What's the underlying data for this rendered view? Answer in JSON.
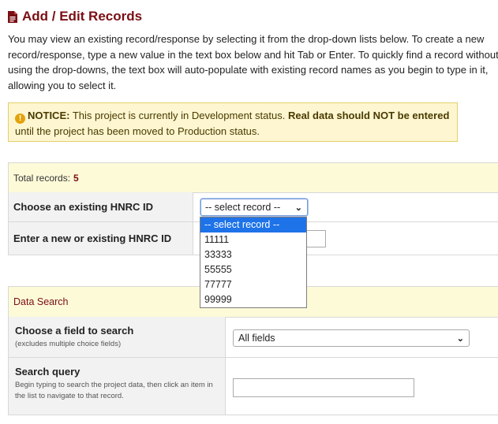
{
  "header": {
    "title": "Add / Edit Records",
    "icon": "document-icon"
  },
  "intro": "You may view an existing record/response by selecting it from the drop-down lists below. To create a new record/response, type a new value in the text box below and hit Tab or Enter. To quickly find a record without using the drop-downs, the text box will auto-populate with existing record names as you begin to type in it, allowing you to select it.",
  "notice": {
    "icon": "warning-icon",
    "label": "NOTICE:",
    "text1": " This project is currently in Development status. ",
    "bold": "Real data should NOT be entered",
    "text2": " until the project has been moved to Production status."
  },
  "records": {
    "total_label": "Total records:",
    "total_count": "5",
    "choose_label": "Choose an existing HNRC ID",
    "select_value": "-- select record --",
    "enter_label": "Enter a new or existing HNRC ID",
    "options": [
      "-- select record --",
      "11111",
      "33333",
      "55555",
      "77777",
      "99999"
    ]
  },
  "search": {
    "heading": "Data Search",
    "field_label": "Choose a field to search",
    "field_sub": "(excludes multiple choice fields)",
    "field_value": "All fields",
    "query_label": "Search query",
    "query_sub": "Begin typing to search the project data, then click an item in the list to navigate to that record."
  },
  "colors": {
    "accent": "#7a0f14",
    "notice_bg": "#fdf6d0",
    "selected": "#1e73e8"
  }
}
